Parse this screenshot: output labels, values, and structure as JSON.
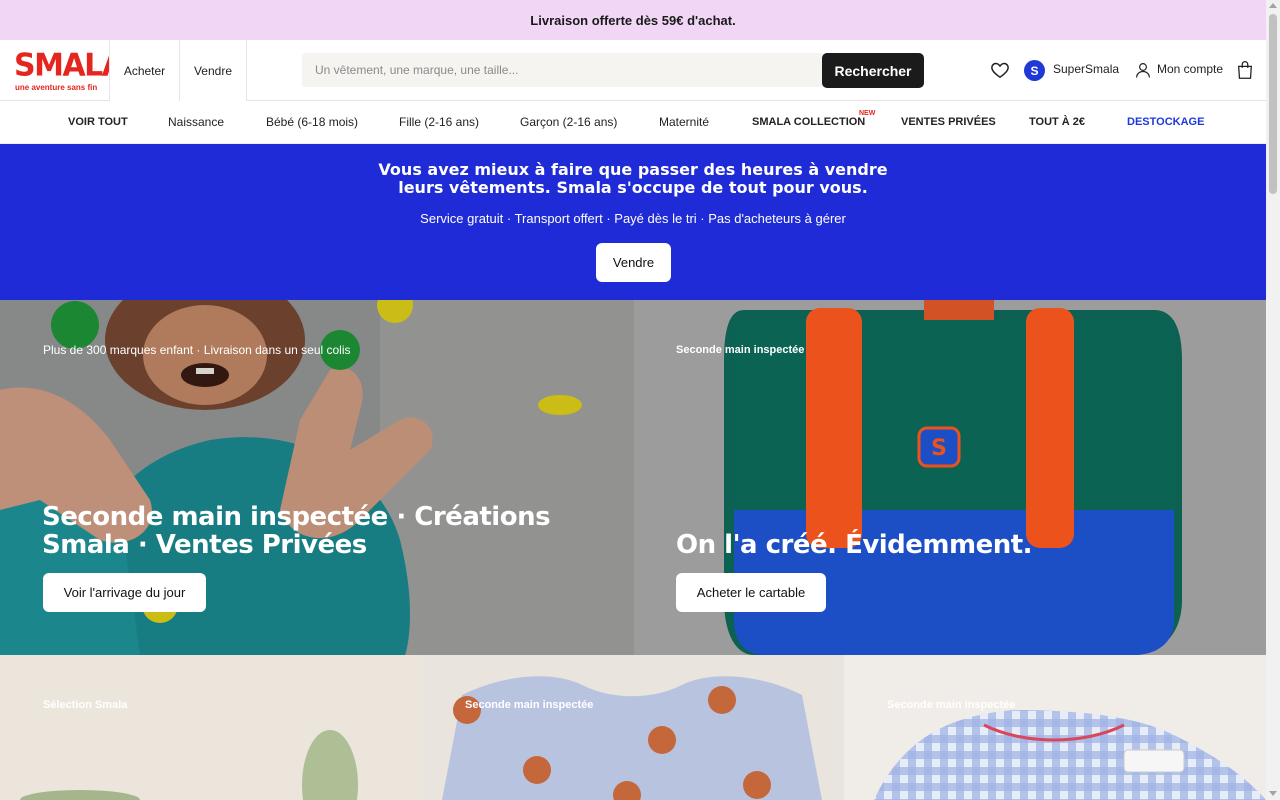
{
  "promo": {
    "text": "Livraison offerte dès 59€ d'achat."
  },
  "header": {
    "logo_text": "SMALA",
    "logo_tagline": "une aventure sans fin",
    "tabs": [
      {
        "label": "Acheter"
      },
      {
        "label": "Vendre"
      }
    ],
    "search": {
      "placeholder": "Un vêtement, une marque, une taille...",
      "button_label": "Rechercher"
    },
    "super_label": "SuperSmala",
    "super_avatar": "S",
    "account_label": "Mon compte",
    "icons": [
      "heart-icon",
      "user-icon",
      "bag-icon"
    ]
  },
  "nav": {
    "items": [
      {
        "label": "VOIR TOUT"
      },
      {
        "label": "Naissance"
      },
      {
        "label": "Bébé (6-18 mois)"
      },
      {
        "label": "Fille (2-16 ans)"
      },
      {
        "label": "Garçon (2-16 ans)"
      },
      {
        "label": "Maternité"
      },
      {
        "label": "SMALA COLLECTION",
        "badge": "NEW"
      },
      {
        "label": "VENTES PRIVÉES"
      },
      {
        "label": "TOUT À 2€"
      },
      {
        "label": "DESTOCKAGE"
      }
    ]
  },
  "hero": {
    "title_line1": "Vous avez mieux à faire que passer des heures à vendre",
    "title_line2": "leurs vêtements. Smala s'occupe de tout pour vous.",
    "subtitle": "Service gratuit · Transport offert · Payé dès le tri · Pas d'acheteurs à gérer",
    "button_label": "Vendre",
    "background": "#1f2bd6"
  },
  "panels": [
    {
      "kicker": "Plus de 300 marques enfant · Livraison dans un seul colis",
      "title_line1": "Seconde main inspectée · Créations",
      "title_line2": "Smala · Ventes Privées",
      "button_label": "Voir l'arrivage du jour"
    },
    {
      "kicker": "Seconde main inspectée",
      "title_line1": "On l'a créé. Évidemment.",
      "button_label": "Acheter le cartable"
    }
  ],
  "bottom_panels": [
    {
      "kicker": "Sélection Smala"
    },
    {
      "kicker": "Seconde main inspectée"
    },
    {
      "kicker": "Seconde main inspectée"
    }
  ],
  "colors": {
    "brand_red": "#e5261f",
    "brand_blue": "#1f2bd6",
    "promo_bg": "#f1d6f6"
  }
}
